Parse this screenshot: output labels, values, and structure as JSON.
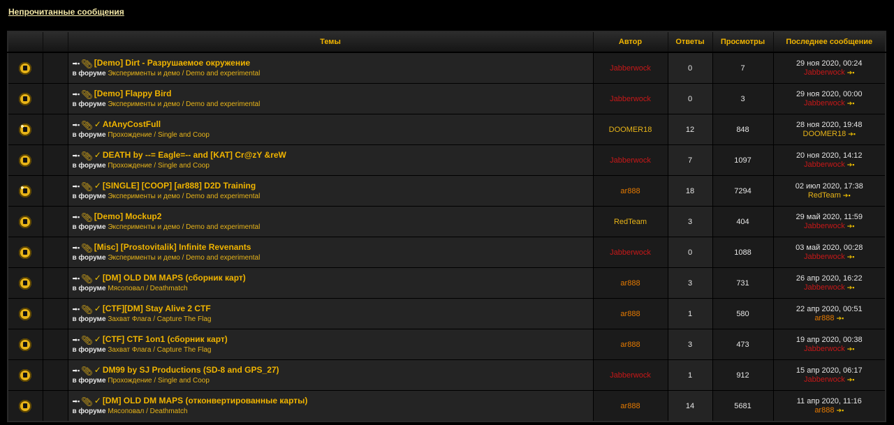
{
  "page_title": "Непрочитанные сообщения",
  "headers": {
    "icon": "",
    "blank": "",
    "topics": "Темы",
    "author": "Автор",
    "replies": "Ответы",
    "views": "Просмотры",
    "last_post": "Последнее сообщение"
  },
  "in_forum_label": "в форуме",
  "topics": [
    {
      "icon": "folder-new",
      "check": false,
      "title": "[Demo] Dirt - Разрушаемое окружение",
      "forum": "Эксперименты и демо / Demo and experimental",
      "author": "Jabberwock",
      "author_color": "red",
      "replies": "0",
      "views": "7",
      "last_date": "29 ноя 2020, 00:24",
      "last_user": "Jabberwock",
      "last_user_color": "red"
    },
    {
      "icon": "folder-new",
      "check": false,
      "title": "[Demo] Flappy Bird",
      "forum": "Эксперименты и демо / Demo and experimental",
      "author": "Jabberwock",
      "author_color": "red",
      "replies": "0",
      "views": "3",
      "last_date": "29 ноя 2020, 00:00",
      "last_user": "Jabberwock",
      "last_user_color": "red"
    },
    {
      "icon": "folder-hot",
      "check": true,
      "title": "AtAnyCostFull",
      "forum": "Прохождение / Single and Coop",
      "author": "DOOMER18",
      "author_color": "gold",
      "replies": "12",
      "views": "848",
      "last_date": "28 ноя 2020, 19:48",
      "last_user": "DOOMER18",
      "last_user_color": "gold"
    },
    {
      "icon": "folder-new",
      "check": true,
      "title": "DEATH by --= Eagle=-- and [KAT] Cr@zY &reW",
      "forum": "Прохождение / Single and Coop",
      "author": "Jabberwock",
      "author_color": "red",
      "replies": "7",
      "views": "1097",
      "last_date": "20 ноя 2020, 14:12",
      "last_user": "Jabberwock",
      "last_user_color": "red"
    },
    {
      "icon": "folder-hot",
      "check": true,
      "title": "[SINGLE] [COOP] [ar888] D2D Training",
      "forum": "Эксперименты и демо / Demo and experimental",
      "author": "ar888",
      "author_color": "orange",
      "replies": "18",
      "views": "7294",
      "last_date": "02 июл 2020, 17:38",
      "last_user": "RedTeam",
      "last_user_color": "gold"
    },
    {
      "icon": "folder-new",
      "check": false,
      "title": "[Demo] Mockup2",
      "forum": "Эксперименты и демо / Demo and experimental",
      "author": "RedTeam",
      "author_color": "gold",
      "replies": "3",
      "views": "404",
      "last_date": "29 май 2020, 11:59",
      "last_user": "Jabberwock",
      "last_user_color": "red"
    },
    {
      "icon": "folder-new",
      "check": false,
      "title": "[Misc] [Prostovitalik] Infinite Revenants",
      "forum": "Эксперименты и демо / Demo and experimental",
      "author": "Jabberwock",
      "author_color": "red",
      "replies": "0",
      "views": "1088",
      "last_date": "03 май 2020, 00:28",
      "last_user": "Jabberwock",
      "last_user_color": "red"
    },
    {
      "icon": "folder-new",
      "check": true,
      "title": "[DM] OLD DM MAPS (сборник карт)",
      "forum": "Мясоповал / Deathmatch",
      "author": "ar888",
      "author_color": "orange",
      "replies": "3",
      "views": "731",
      "last_date": "26 апр 2020, 16:22",
      "last_user": "Jabberwock",
      "last_user_color": "red"
    },
    {
      "icon": "folder-new",
      "check": true,
      "title": "[CTF][DM] Stay Alive 2 CTF",
      "forum": "Захват Флага / Capture The Flag",
      "author": "ar888",
      "author_color": "orange",
      "replies": "1",
      "views": "580",
      "last_date": "22 апр 2020, 00:51",
      "last_user": "ar888",
      "last_user_color": "orange"
    },
    {
      "icon": "folder-new",
      "check": true,
      "title": "[CTF] CTF 1on1 (сборник карт)",
      "forum": "Захват Флага / Capture The Flag",
      "author": "ar888",
      "author_color": "orange",
      "replies": "3",
      "views": "473",
      "last_date": "19 апр 2020, 00:38",
      "last_user": "Jabberwock",
      "last_user_color": "red"
    },
    {
      "icon": "folder-new",
      "check": true,
      "title": "DM99 by SJ Productions (SD-8 and GPS_27)",
      "forum": "Прохождение / Single and Coop",
      "author": "Jabberwock",
      "author_color": "red",
      "replies": "1",
      "views": "912",
      "last_date": "15 апр 2020, 06:17",
      "last_user": "Jabberwock",
      "last_user_color": "red"
    },
    {
      "icon": "folder-new",
      "check": true,
      "title": "[DM] OLD DM MAPS (отконвертированные карты)",
      "forum": "Мясоповал / Deathmatch",
      "author": "ar888",
      "author_color": "orange",
      "replies": "14",
      "views": "5681",
      "last_date": "11 апр 2020, 11:16",
      "last_user": "ar888",
      "last_user_color": "orange"
    }
  ]
}
